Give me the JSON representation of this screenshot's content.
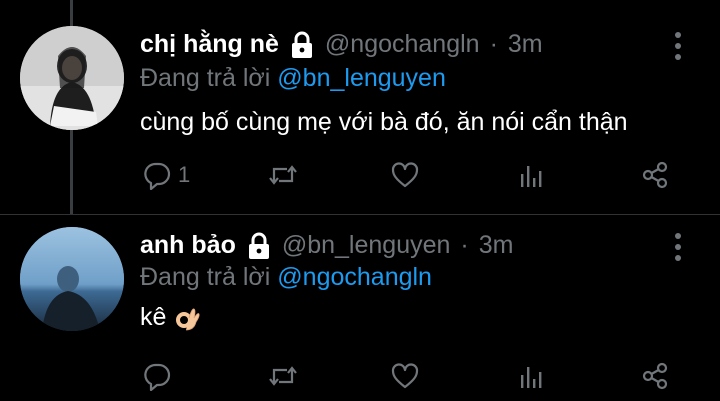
{
  "tweets": [
    {
      "display_name": "chị hằng nè",
      "handle": "@ngochangln",
      "time_separator": "·",
      "time": "3m",
      "replying_to_label": "Đang trả lời",
      "replying_to_handle": "@bn_lenguyen",
      "text": "cùng bố cùng mẹ với bà đó, ăn nói cẩn thận",
      "reply_count": "1",
      "icons": [
        "lock-icon",
        "more-icon",
        "reply-icon",
        "retweet-icon",
        "like-icon",
        "stats-icon",
        "share-icon"
      ]
    },
    {
      "display_name": "anh bảo",
      "handle": "@bn_lenguyen",
      "time_separator": "·",
      "time": "3m",
      "replying_to_label": "Đang trả lời",
      "replying_to_handle": "@ngochangln",
      "text": "kê",
      "emoji": "ok-hand-emoji",
      "reply_count": "",
      "icons": [
        "lock-icon",
        "more-icon",
        "reply-icon",
        "retweet-icon",
        "like-icon",
        "stats-icon",
        "share-icon"
      ]
    }
  ],
  "colors": {
    "background": "#000000",
    "text_primary": "#ffffff",
    "text_secondary": "#71767b",
    "mention": "#1d9bf0",
    "divider": "#2f3336"
  }
}
